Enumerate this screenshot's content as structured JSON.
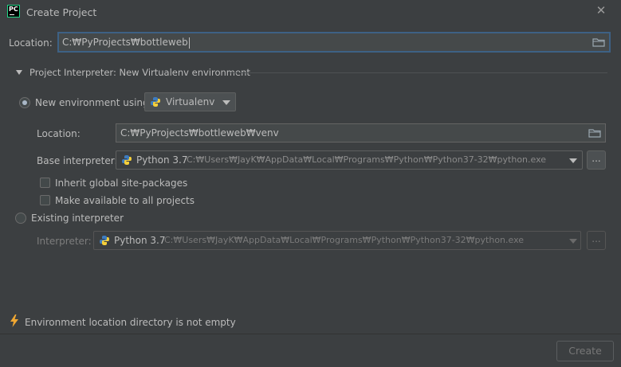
{
  "window": {
    "title": "Create Project",
    "app_icon_text": "PC"
  },
  "location": {
    "label": "Location:",
    "value": "C:₩PyProjects₩bottleweb"
  },
  "interpreter_section": {
    "title": "Project Interpreter: New Virtualenv environment"
  },
  "new_env": {
    "radio_label": "New environment using",
    "selected": true,
    "tool": "Virtualenv",
    "location_label": "Location:",
    "location_value": "C:₩PyProjects₩bottleweb₩venv",
    "base_label": "Base interpreter:",
    "base_name": "Python 3.7",
    "base_path": "C:₩Users₩JayK₩AppData₩Local₩Programs₩Python₩Python37-32₩python.exe",
    "inherit_label": "Inherit global site-packages",
    "inherit_checked": false,
    "available_label": "Make available to all projects",
    "available_checked": false,
    "browse_label": "..."
  },
  "existing": {
    "radio_label": "Existing interpreter",
    "selected": false,
    "interpreter_label": "Interpreter:",
    "interpreter_name": "Python 3.7",
    "interpreter_path": "C:₩Users₩JayK₩AppData₩Local₩Programs₩Python₩Python37-32₩python.exe",
    "browse_label": "..."
  },
  "warning": {
    "icon": "lightning-icon",
    "text": "Environment location directory is not empty",
    "color": "#f0a732"
  },
  "buttons": {
    "create": "Create"
  }
}
